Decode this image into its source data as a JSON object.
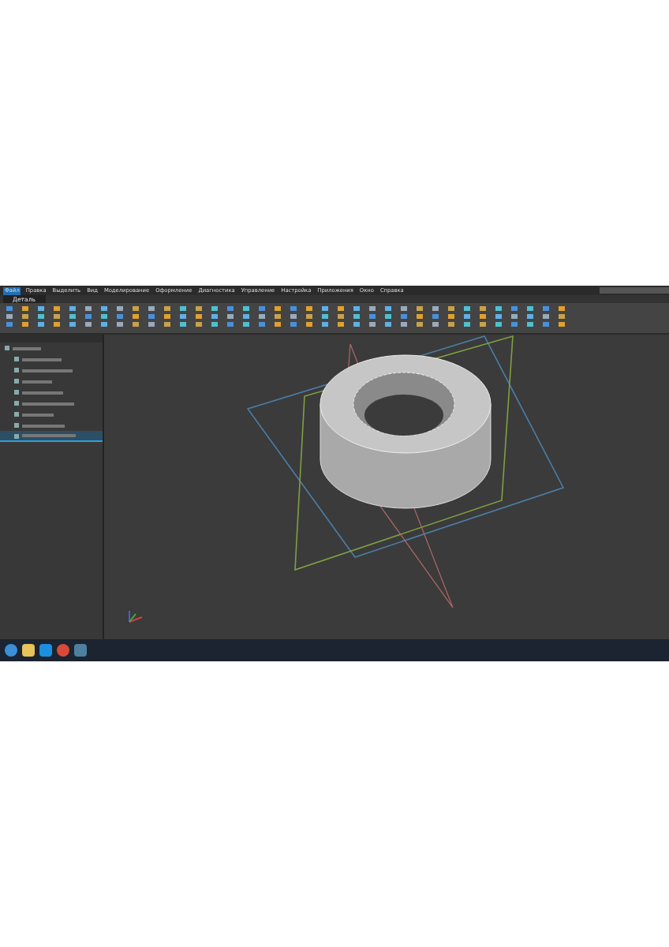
{
  "menu": [
    {
      "label": "Файл",
      "selected": true
    },
    {
      "label": "Правка",
      "selected": false
    },
    {
      "label": "Выделить",
      "selected": false
    },
    {
      "label": "Вид",
      "selected": false
    },
    {
      "label": "Моделирование",
      "selected": false
    },
    {
      "label": "Оформление",
      "selected": false
    },
    {
      "label": "Диагностика",
      "selected": false
    },
    {
      "label": "Управление",
      "selected": false
    },
    {
      "label": "Настройка",
      "selected": false
    },
    {
      "label": "Приложения",
      "selected": false
    },
    {
      "label": "Окно",
      "selected": false
    },
    {
      "label": "Справка",
      "selected": false
    }
  ],
  "document_tab": {
    "label": "Деталь"
  },
  "tree": {
    "items": [
      {
        "selected": false,
        "children": [
          {
            "selected": false
          },
          {
            "selected": false
          },
          {
            "selected": false
          },
          {
            "selected": false
          },
          {
            "selected": false
          },
          {
            "selected": false
          },
          {
            "selected": false
          },
          {
            "selected": true
          }
        ]
      }
    ]
  }
}
